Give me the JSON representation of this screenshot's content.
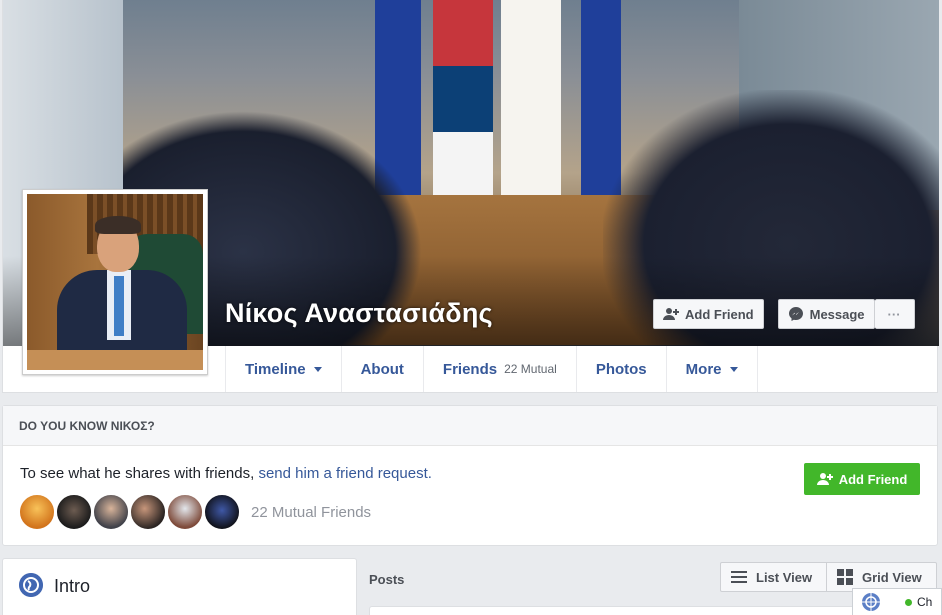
{
  "profile": {
    "name": "Νίκος Αναστασιάδης"
  },
  "cover_actions": {
    "add_friend_label": "Add Friend",
    "message_label": "Message",
    "more_label": "···"
  },
  "nav": {
    "tabs": [
      {
        "label": "Timeline",
        "has_caret": true
      },
      {
        "label": "About"
      },
      {
        "label": "Friends",
        "extra": "22 Mutual"
      },
      {
        "label": "Photos"
      },
      {
        "label": "More",
        "has_caret": true
      }
    ]
  },
  "know": {
    "heading": "DO YOU KNOW ΝΙΚΟΣ?",
    "text_prefix": "To see what he shares with friends,",
    "link_text": "send him a friend request.",
    "button_label": "Add Friend",
    "mutual_friends": "22 Mutual Friends"
  },
  "intro": {
    "title": "Intro"
  },
  "posts": {
    "label": "Posts",
    "list_view_label": "List View",
    "grid_view_label": "Grid View"
  },
  "chat": {
    "label": "Ch"
  },
  "colors": {
    "link_blue": "#365899",
    "green_button": "#42b72a",
    "page_bg": "#e9ebee"
  }
}
